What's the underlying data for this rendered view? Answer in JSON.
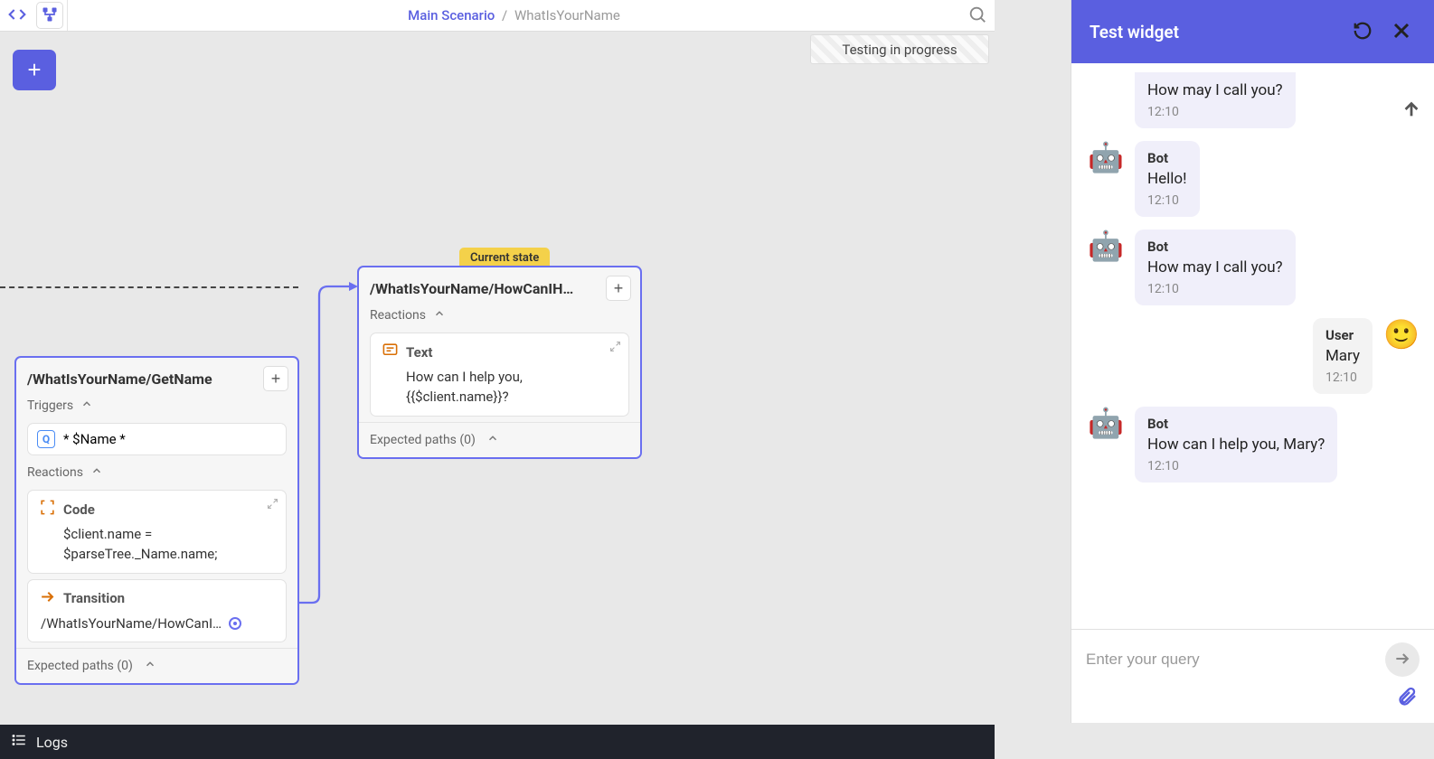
{
  "breadcrumb": {
    "root": "Main Scenario",
    "leaf": "WhatIsYourName"
  },
  "status_banner": "Testing in progress",
  "logs_label": "Logs",
  "nodes": {
    "getname": {
      "title": "/WhatIsYourName/GetName",
      "triggers_label": "Triggers",
      "trigger_value": "* $Name *",
      "reactions_label": "Reactions",
      "code_label": "Code",
      "code_body": "$client.name = $parseTree._Name.name;",
      "transition_label": "Transition",
      "transition_target": "/WhatIsYourName/HowCanI…",
      "expected_label": "Expected paths (0)"
    },
    "howcanihelp": {
      "current_state_label": "Current state",
      "title": "/WhatIsYourName/HowCanIH…",
      "reactions_label": "Reactions",
      "text_label": "Text",
      "text_body": "How can I help you, {{$client.name}}?",
      "expected_label": "Expected paths (0)"
    }
  },
  "panel": {
    "title": "Test widget",
    "input_placeholder": "Enter your query",
    "messages": [
      {
        "role": "bot",
        "sender": "Bot",
        "text": "How may I call you?",
        "time": "12:10",
        "partial": true
      },
      {
        "role": "bot",
        "sender": "Bot",
        "text": "Hello!",
        "time": "12:10"
      },
      {
        "role": "bot",
        "sender": "Bot",
        "text": "How may I call you?",
        "time": "12:10"
      },
      {
        "role": "user",
        "sender": "User",
        "text": "Mary",
        "time": "12:10"
      },
      {
        "role": "bot",
        "sender": "Bot",
        "text": "How can I help you, Mary?",
        "time": "12:10"
      }
    ]
  }
}
